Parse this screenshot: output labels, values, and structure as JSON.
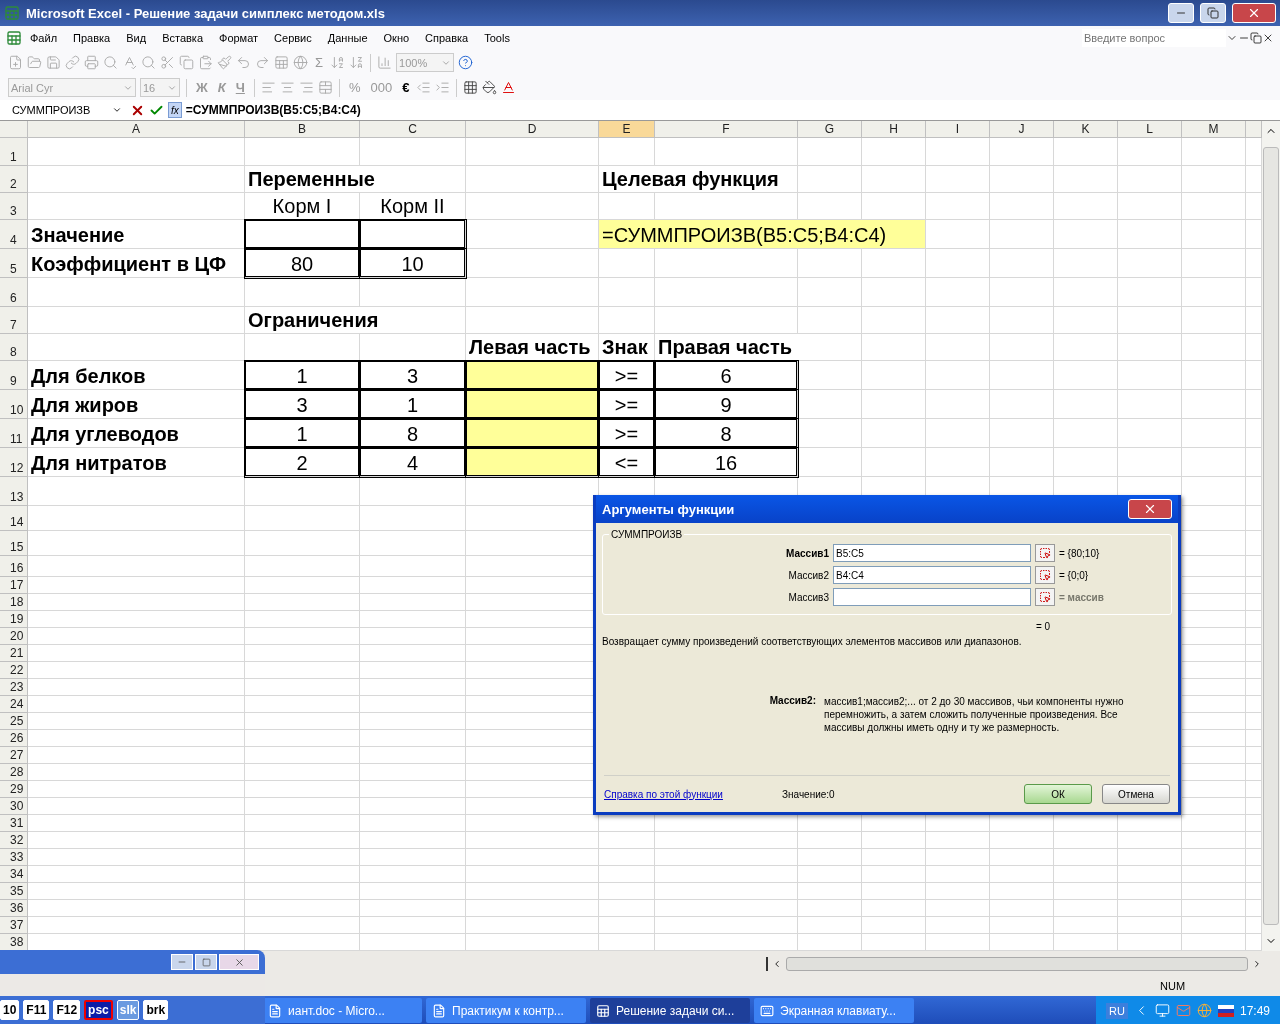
{
  "window": {
    "title": "Microsoft Excel - Решение задачи симплекс методом.xls"
  },
  "menu": {
    "items": [
      "Файл",
      "Правка",
      "Вид",
      "Вставка",
      "Формат",
      "Сервис",
      "Данные",
      "Окно",
      "Справка",
      "Tools"
    ],
    "help_placeholder": "Введите вопрос"
  },
  "standard_toolbar": {
    "sum": "Σ",
    "zoom": "100%"
  },
  "format_toolbar": {
    "font": "Arial Cyr",
    "size": "16",
    "style_buttons": [
      "Ж",
      "К",
      "Ч"
    ],
    "number_buttons": [
      "%",
      "000",
      "€"
    ]
  },
  "formula_bar": {
    "name_box": "СУММПРОИЗВ",
    "fx": "fx",
    "formula": "=СУММПРОИЗВ(B5:C5;B4:C4)"
  },
  "columns": [
    {
      "label": "A",
      "selected": false
    },
    {
      "label": "B",
      "selected": false
    },
    {
      "label": "C",
      "selected": false
    },
    {
      "label": "D",
      "selected": false
    },
    {
      "label": "E",
      "selected": true
    },
    {
      "label": "F",
      "selected": false
    },
    {
      "label": "G",
      "selected": false
    },
    {
      "label": "H",
      "selected": false
    },
    {
      "label": "I",
      "selected": false
    },
    {
      "label": "J",
      "selected": false
    },
    {
      "label": "K",
      "selected": false
    },
    {
      "label": "L",
      "selected": false
    },
    {
      "label": "M",
      "selected": false
    }
  ],
  "rows": [
    {
      "number": "1",
      "cells": []
    },
    {
      "number": "2",
      "cells": [
        {},
        {
          "text": "Переменные",
          "bold": true
        },
        {},
        {},
        {
          "text": "Целевая функция",
          "bold": true
        }
      ]
    },
    {
      "number": "3",
      "cells": [
        {},
        {
          "text": "Корм I"
        },
        {
          "text": "Корм II"
        }
      ]
    },
    {
      "number": "4",
      "cells": [
        {
          "text": "Значение",
          "bold": true
        },
        {
          "bordered": true
        },
        {
          "bordered": true
        },
        {},
        {
          "text": "=СУММПРОИЗВ(B5:C5;B4:C4)",
          "editing": true,
          "highlight": true
        }
      ]
    },
    {
      "number": "5",
      "cells": [
        {
          "text": "Коэффициент в ЦФ",
          "bold": true
        },
        {
          "text": "80",
          "bordered": true
        },
        {
          "text": "10",
          "bordered": true
        }
      ]
    },
    {
      "number": "6",
      "cells": []
    },
    {
      "number": "7",
      "cells": [
        {},
        {
          "text": "Ограничения",
          "bold": true
        }
      ]
    },
    {
      "number": "8",
      "cells": [
        {},
        {},
        {},
        {
          "text": "Левая часть",
          "bold": true
        },
        {
          "text": "Знак",
          "bold": true
        },
        {
          "text": "Правая часть",
          "bold": true
        }
      ]
    },
    {
      "number": "9",
      "cells": [
        {
          "text": "Для белков",
          "bold": true
        },
        {
          "text": "1",
          "bordered": true
        },
        {
          "text": "3",
          "bordered": true
        },
        {
          "bordered": true,
          "highlight": true
        },
        {
          "text": ">=",
          "bordered": true
        },
        {
          "text": "6",
          "bordered": true
        }
      ]
    },
    {
      "number": "10",
      "cells": [
        {
          "text": "Для жиров",
          "bold": true
        },
        {
          "text": "3",
          "bordered": true
        },
        {
          "text": "1",
          "bordered": true
        },
        {
          "bordered": true,
          "highlight": true
        },
        {
          "text": ">=",
          "bordered": true
        },
        {
          "text": "9",
          "bordered": true
        }
      ]
    },
    {
      "number": "11",
      "cells": [
        {
          "text": "Для углеводов",
          "bold": true
        },
        {
          "text": "1",
          "bordered": true
        },
        {
          "text": "8",
          "bordered": true
        },
        {
          "bordered": true,
          "highlight": true
        },
        {
          "text": ">=",
          "bordered": true
        },
        {
          "text": "8",
          "bordered": true
        }
      ]
    },
    {
      "number": "12",
      "cells": [
        {
          "text": "Для нитратов",
          "bold": true
        },
        {
          "text": "2",
          "bordered": true
        },
        {
          "text": "4",
          "bordered": true
        },
        {
          "bordered": true,
          "highlight": true
        },
        {
          "text": "<=",
          "bordered": true
        },
        {
          "text": "16",
          "bordered": true
        }
      ]
    },
    {
      "number": "13",
      "cells": []
    },
    {
      "number": "14",
      "cells": []
    },
    {
      "number": "15",
      "cells": []
    },
    {
      "number": "16",
      "cells": []
    },
    {
      "number": "17",
      "cells": []
    },
    {
      "number": "18",
      "cells": []
    },
    {
      "number": "19",
      "cells": []
    },
    {
      "number": "20",
      "cells": []
    },
    {
      "number": "21",
      "cells": []
    },
    {
      "number": "22",
      "cells": []
    },
    {
      "number": "23",
      "cells": []
    },
    {
      "number": "24",
      "cells": []
    },
    {
      "number": "25",
      "cells": []
    },
    {
      "number": "26",
      "cells": []
    },
    {
      "number": "27",
      "cells": []
    },
    {
      "number": "28",
      "cells": []
    },
    {
      "number": "29",
      "cells": []
    },
    {
      "number": "30",
      "cells": []
    },
    {
      "number": "31",
      "cells": []
    },
    {
      "number": "32",
      "cells": []
    },
    {
      "number": "33",
      "cells": []
    },
    {
      "number": "34",
      "cells": []
    },
    {
      "number": "35",
      "cells": []
    },
    {
      "number": "36",
      "cells": []
    },
    {
      "number": "37",
      "cells": []
    },
    {
      "number": "38",
      "cells": []
    }
  ],
  "dialog": {
    "title": "Аргументы функции",
    "function": "СУММПРОИЗВ",
    "arguments": [
      {
        "label": "Массив1",
        "value": "B5:C5",
        "result": "= {80;10}",
        "bold": true,
        "faded": false
      },
      {
        "label": "Массив2",
        "value": "B4:C4",
        "result": "= {0;0}",
        "bold": false,
        "faded": false
      },
      {
        "label": "Массив3",
        "result": "= массив",
        "bold": false,
        "faded": true
      }
    ],
    "total": "= 0",
    "description": "Возвращает сумму произведений соответствующих элементов массивов или диапазонов.",
    "arg_name": "Массив2:",
    "arg_help": "массив1;массив2;... от 2 до 30 массивов, чьи компоненты нужно перемножить, а затем сложить полученные произведения. Все массивы должны иметь одну и ту же размерность.",
    "help_link": "Справка по этой функции",
    "value": "Значение:0",
    "buttons": [
      {
        "label": "ОК",
        "kind": "default"
      },
      {
        "label": "Отмена",
        "kind": "normal"
      }
    ]
  },
  "status_bar": {
    "mode": "NUM"
  },
  "keyboard": {
    "keys": [
      {
        "label": "10",
        "focused": false,
        "lit": false
      },
      {
        "label": "F11",
        "focused": false,
        "lit": false
      },
      {
        "label": "F12",
        "focused": false,
        "lit": false
      },
      {
        "label": "psc",
        "focused": true,
        "lit": false
      },
      {
        "label": "slk",
        "focused": false,
        "lit": true
      },
      {
        "label": "brk",
        "focused": false,
        "lit": false
      }
    ]
  },
  "taskbar": {
    "items": [
      {
        "label": "иант.doc - Micro...",
        "kind": "doc",
        "selected": false
      },
      {
        "label": "Практикум к контр...",
        "kind": "doc",
        "selected": false
      },
      {
        "label": "Решение задачи си...",
        "kind": "sheet",
        "selected": true
      },
      {
        "label": "Экранная клавиату...",
        "kind": "keyboard",
        "selected": false
      }
    ],
    "language": "RU",
    "clock": "17:49"
  }
}
